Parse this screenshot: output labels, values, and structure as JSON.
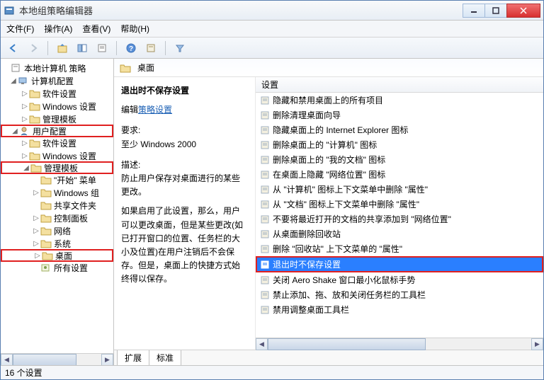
{
  "window": {
    "title": "本地组策略编辑器"
  },
  "menu": {
    "file": "文件(F)",
    "action": "操作(A)",
    "view": "查看(V)",
    "help": "帮助(H)"
  },
  "tree": {
    "root": "本地计算机 策略",
    "computer": "计算机配置",
    "comp_soft": "软件设置",
    "comp_win": "Windows 设置",
    "comp_tmpl": "管理模板",
    "user": "用户配置",
    "user_soft": "软件设置",
    "user_win": "Windows 设置",
    "user_tmpl": "管理模板",
    "start": "\"开始\" 菜单",
    "wincomp": "Windows 组",
    "share": "共享文件夹",
    "ctrl": "控制面板",
    "net": "网络",
    "sys": "系统",
    "desktop": "桌面",
    "allset": "所有设置"
  },
  "header": {
    "title": "桌面"
  },
  "desc": {
    "title": "退出时不保存设置",
    "edit_prefix": "编辑",
    "edit_link": "策略设置",
    "req_label": "要求:",
    "req_text": "至少 Windows 2000",
    "desc_label": "描述:",
    "desc_text": "防止用户保存对桌面进行的某些更改。",
    "desc_text2": "如果启用了此设置，那么，用户可以更改桌面，但是某些更改(如已打开窗口的位置、任务栏的大小及位置)在用户注销后不会保存。但是，桌面上的快捷方式始终得以保存。"
  },
  "listhead": "设置",
  "settings": [
    "隐藏和禁用桌面上的所有项目",
    "删除清理桌面向导",
    "隐藏桌面上的 Internet Explorer 图标",
    "删除桌面上的 \"计算机\" 图标",
    "删除桌面上的 \"我的文档\" 图标",
    "在桌面上隐藏 \"网络位置\" 图标",
    "从 \"计算机\" 图标上下文菜单中删除 \"属性\"",
    "从 \"文档\" 图标上下文菜单中删除 \"属性\"",
    "不要将最近打开的文档的共享添加到 \"网络位置\"",
    "从桌面删除回收站",
    "删除 \"回收站\" 上下文菜单的 \"属性\"",
    "退出时不保存设置",
    "关闭 Aero Shake 窗口最小化鼠标手势",
    "禁止添加、拖、放和关闭任务栏的工具栏",
    "禁用调整桌面工具栏"
  ],
  "selected_index": 11,
  "tabs": {
    "ext": "扩展",
    "std": "标准"
  },
  "status": "16 个设置"
}
